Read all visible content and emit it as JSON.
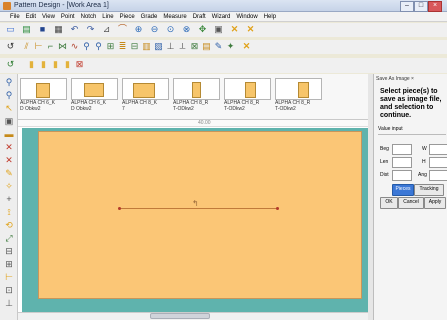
{
  "window": {
    "title": "Pattern Design - [Work Area 1]",
    "min_label": "–",
    "max_label": "□",
    "close_label": "×"
  },
  "menu": [
    "File",
    "Edit",
    "View",
    "Point",
    "Notch",
    "Line",
    "Piece",
    "Grade",
    "Measure",
    "Draft",
    "Wizard",
    "Window",
    "Help"
  ],
  "toolbar1": [
    "new-icon",
    "open-icon",
    "save-icon",
    "print-icon",
    "undo-icon",
    "redo-icon",
    "measure-icon",
    "arc-icon",
    "zoom-in-icon",
    "zoom-out-icon",
    "zoom-fit-icon",
    "zoom-area-icon",
    "pan-icon",
    "select-icon",
    "close-x-icon",
    "close-x2-icon"
  ],
  "toolbar2": [
    "undo-icon",
    "grade-icon",
    "notch-icon",
    "fold-icon",
    "mirror-icon",
    "curve-icon",
    "search-icon",
    "search-plus-icon",
    "tool-icon",
    "tool2-icon",
    "tool3-icon",
    "tool4-icon",
    "tool5-icon",
    "tool6-icon",
    "tool7-icon",
    "tool8-icon",
    "tool9-icon",
    "tool10-icon",
    "tool11-icon",
    "close-x-icon"
  ],
  "toolbar3": [
    "piece-icon",
    "piece2-icon",
    "piece3-icon",
    "piece4-icon",
    "piece5-icon"
  ],
  "pieces": [
    {
      "label": "ALPHA CH 6_K",
      "sub": "D Obkw2"
    },
    {
      "label": "ALPHA CH 6_K",
      "sub": "D Obkw2"
    },
    {
      "label": "ALPHA CH 8_K",
      "sub": "7"
    },
    {
      "label": "ALPHA CH 8_R",
      "sub": "T-ODkw2"
    },
    {
      "label": "ALPHA CH 8_R",
      "sub": "T-ODkw2"
    },
    {
      "label": "ALPHA CH 8_R",
      "sub": "T-ODkw2"
    }
  ],
  "ruler_label": "40.00",
  "panel": {
    "tab": "Save As Image ×",
    "description": "Select piece(s) to save as image file, and selection to continue.",
    "section": "Value input",
    "fields": [
      {
        "label": "Beg"
      },
      {
        "label": "Len"
      },
      {
        "label": "Dist"
      }
    ],
    "field_right": [
      "W",
      "H",
      "Ang"
    ],
    "buttons": {
      "pieces": "Pieces",
      "tracking": "Tracking",
      "ok": "OK",
      "cancel": "Cancel",
      "apply": "Apply"
    }
  }
}
